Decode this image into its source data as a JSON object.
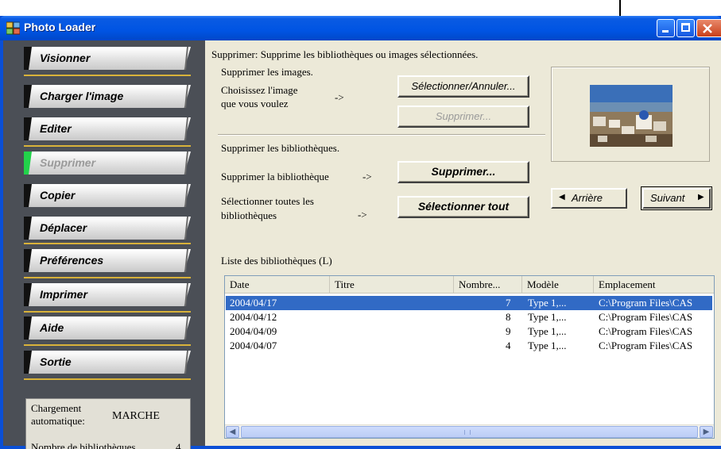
{
  "window": {
    "title": "Photo Loader"
  },
  "titlebar_buttons": {
    "minimize": "minimize",
    "maximize": "maximize",
    "close": "close"
  },
  "sidebar": {
    "items": [
      {
        "label": "Visionner",
        "active": false
      },
      {
        "label": "Charger l'image",
        "active": false
      },
      {
        "label": "Editer",
        "active": false
      },
      {
        "label": "Supprimer",
        "active": true
      },
      {
        "label": "Copier",
        "active": false
      },
      {
        "label": "Déplacer",
        "active": false
      },
      {
        "label": "Préférences",
        "active": false
      },
      {
        "label": "Imprimer",
        "active": false
      },
      {
        "label": "Aide",
        "active": false
      },
      {
        "label": "Sortie",
        "active": false
      }
    ],
    "status": {
      "auto_label_line1": "Chargement",
      "auto_label_line2": "automatique:",
      "auto_value": "MARCHE",
      "count_label": "Nombre de bibliothèques",
      "count_value": "4"
    }
  },
  "main": {
    "header": "Supprimer: Supprime les bibliothèques ou images sélectionnées.",
    "images_section": {
      "title": "Supprimer les images.",
      "hint_line1": "Choisissez l'image",
      "hint_line2": "que vous voulez",
      "arrow": "->",
      "select_button": "Sélectionner/Annuler...",
      "delete_button": "Supprimer..."
    },
    "libraries_section": {
      "title": "Supprimer les bibliothèques.",
      "delete_label": "Supprimer la bibliothèque",
      "arrow1": "->",
      "delete_button": "Supprimer...",
      "select_all_line1": "Sélectionner toutes les",
      "select_all_line2": "bibliothèques",
      "arrow2": "->",
      "select_all_button": "Sélectionner tout"
    },
    "preview": {
      "prev_button": "Arrière",
      "next_button": "Suivant"
    },
    "list": {
      "label": "Liste des bibliothèques (L)",
      "columns": [
        "Date",
        "Titre",
        "Nombre...",
        "Modèle",
        "Emplacement"
      ],
      "rows": [
        {
          "date": "2004/04/17",
          "title": "",
          "count": "7",
          "model": "Type 1,...",
          "location": "C:\\Program Files\\CAS",
          "selected": true
        },
        {
          "date": "2004/04/12",
          "title": "",
          "count": "8",
          "model": "Type 1,...",
          "location": "C:\\Program Files\\CAS",
          "selected": false
        },
        {
          "date": "2004/04/09",
          "title": "",
          "count": "9",
          "model": "Type 1,...",
          "location": "C:\\Program Files\\CAS",
          "selected": false
        },
        {
          "date": "2004/04/07",
          "title": "",
          "count": "4",
          "model": "Type 1,...",
          "location": "C:\\Program Files\\CAS",
          "selected": false
        }
      ]
    }
  },
  "colors": {
    "titlebar": "#0054e3",
    "sidebar": "#4b4f56",
    "active_edge": "#22d24a",
    "separator": "#d8b23a",
    "selection": "#316ac5",
    "dialog": "#ece9d8"
  },
  "icons": {
    "app": "photo-loader-icon",
    "prev": "triangle-left-icon",
    "next": "triangle-right-icon",
    "scroll_left": "scroll-left-icon",
    "scroll_right": "scroll-right-icon"
  }
}
